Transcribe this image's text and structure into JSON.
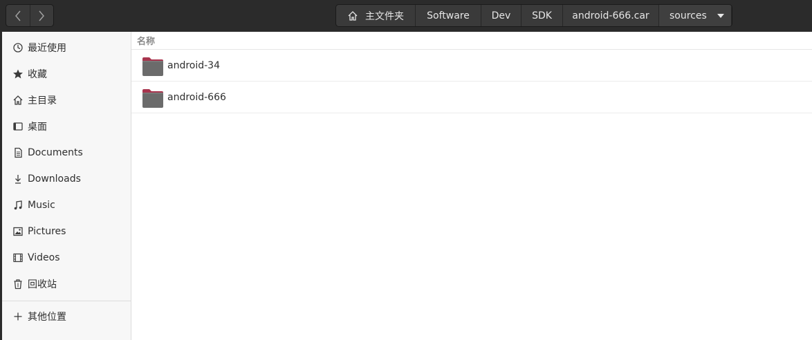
{
  "nav": {
    "back_icon": "chevron-left-icon",
    "forward_icon": "chevron-right-icon"
  },
  "pathbar": {
    "home_icon": "home-icon",
    "crumbs": [
      "主文件夹",
      "Software",
      "Dev",
      "SDK",
      "android-666.car",
      "sources"
    ]
  },
  "sidebar": {
    "items": [
      {
        "label": "最近使用",
        "icon": "clock-icon"
      },
      {
        "label": "收藏",
        "icon": "star-icon"
      },
      {
        "label": "主目录",
        "icon": "home-icon"
      },
      {
        "label": "桌面",
        "icon": "desktop-icon"
      },
      {
        "label": "Documents",
        "icon": "document-icon"
      },
      {
        "label": "Downloads",
        "icon": "download-icon"
      },
      {
        "label": "Music",
        "icon": "music-icon"
      },
      {
        "label": "Pictures",
        "icon": "picture-icon"
      },
      {
        "label": "Videos",
        "icon": "video-icon"
      },
      {
        "label": "回收站",
        "icon": "trash-icon"
      }
    ],
    "other": {
      "label": "其他位置",
      "icon": "plus-icon"
    }
  },
  "main": {
    "column_header": "名称",
    "files": [
      {
        "name": "android-34",
        "icon": "folder-icon"
      },
      {
        "name": "android-666",
        "icon": "folder-icon"
      }
    ]
  },
  "colors": {
    "headerbar": "#2b2b2b",
    "sidebar": "#f7f7f7",
    "folder_body": "#6b6b6b",
    "folder_tab": "#a8354e"
  }
}
